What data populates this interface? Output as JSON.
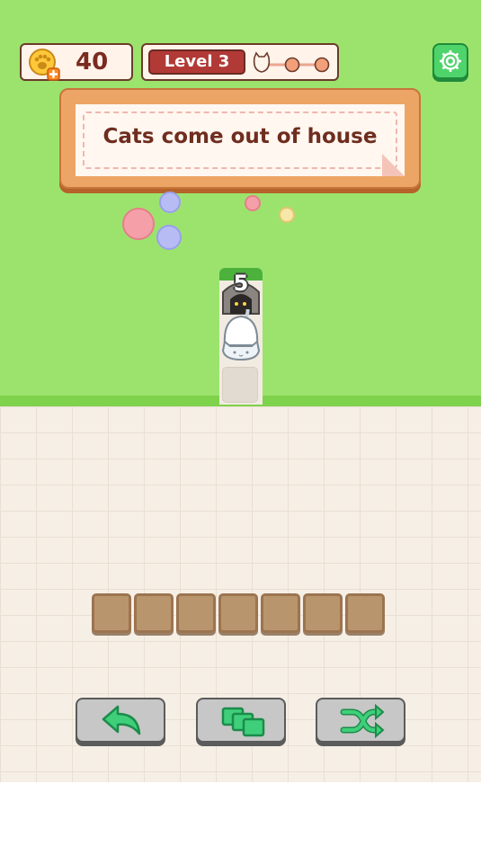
{
  "hud": {
    "coins": "40",
    "level_label": "Level 3",
    "level_progress_steps": 3,
    "level_progress_current": 1
  },
  "tutorial": {
    "message": "Cats come out of house"
  },
  "board": {
    "house_cat_count": "5",
    "tray_slot_count": 7
  },
  "colors": {
    "grass": "#9ce36d",
    "banner": "#eda565",
    "level_pill": "#b13a36",
    "settings_button": "#4fd36b",
    "tray_slot": "#b9956d",
    "action_button": "#c7c7c7",
    "action_icon": "#3fcf7a"
  },
  "icons": {
    "coins": "paw-coin-plus-icon",
    "settings": "gear-icon",
    "undo": "undo-arrow-icon",
    "swap": "stacked-tiles-icon",
    "shuffle": "shuffle-icon"
  }
}
